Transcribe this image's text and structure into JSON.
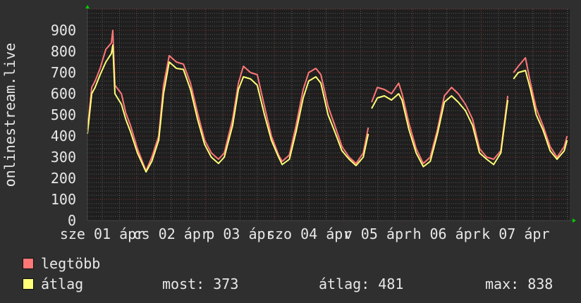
{
  "chart_data": {
    "type": "line",
    "ylabel": "onlinestream.live",
    "ylim": [
      0,
      1000
    ],
    "yticks": [
      0,
      100,
      200,
      300,
      400,
      500,
      600,
      700,
      800,
      900
    ],
    "xlim": [
      "04-01 06:50",
      "04-08 06:50"
    ],
    "xtick_labels": [
      "sze 01 ápr",
      "cs 02 ápr",
      "p 03 ápr",
      "szo 04 ápr",
      "v 05 ápr",
      "h 06 ápr",
      "k 07 ápr"
    ],
    "xtick_times": [
      "04-01 12:00",
      "04-02 12:00",
      "04-03 12:00",
      "04-04 12:00",
      "04-05 12:00",
      "04-06 12:00",
      "04-07 12:00"
    ],
    "grid": true,
    "colors": {
      "background": "#2f2f2f",
      "plot": "#1e1e1e",
      "grid_minor": "#5a5a5a",
      "grid_major": "#8a3a3a",
      "axis_arrow": "#00cc00"
    },
    "x": [
      "04-01 06:50",
      "04-01 08:20",
      "04-01 09:30",
      "04-01 11:15",
      "04-01 13:15",
      "04-01 15:10",
      "04-01 15:40",
      "04-01 16:25",
      "04-01 18:40",
      "04-01 20:10",
      "04-01 21:50",
      "04-02 00:15",
      "04-02 03:15",
      "04-02 05:15",
      "04-02 07:40",
      "04-02 09:20",
      "04-02 11:20",
      "04-02 13:50",
      "04-02 16:15",
      "04-02 18:45",
      "04-02 21:10",
      "04-02 23:40",
      "04-03 02:00",
      "04-03 04:30",
      "04-03 06:30",
      "04-03 09:25",
      "04-03 11:25",
      "04-03 13:10",
      "04-03 15:40",
      "04-03 18:00",
      "04-03 20:30",
      "04-03 22:55",
      "04-04 01:25",
      "04-04 02:40",
      "04-04 05:10",
      "04-04 07:30",
      "04-04 10:00",
      "04-04 11:55",
      "04-04 14:25",
      "04-04 16:10",
      "04-04 18:40",
      "04-04 21:00",
      "04-04 23:30",
      "04-05 02:00",
      "04-05 04:25",
      "04-05 06:55",
      "04-05 08:40",
      "04-05 09:15",
      "04-05 09:50",
      "04-05 11:50",
      "04-05 14:15",
      "04-05 16:45",
      "04-05 19:15",
      "04-05 20:25",
      "04-05 22:50",
      "04-06 01:20",
      "04-06 03:50",
      "04-06 06:15",
      "04-06 08:45",
      "04-06 11:10",
      "04-06 13:40",
      "04-06 16:00",
      "04-06 18:30",
      "04-06 21:00",
      "04-06 23:25",
      "04-07 01:55",
      "04-07 04:20",
      "04-07 06:50",
      "04-07 09:15",
      "04-07 10:15",
      "04-07 11:15",
      "04-07 12:55",
      "04-07 15:25",
      "04-07 17:10",
      "04-07 19:10",
      "04-07 21:30",
      "04-08 00:00",
      "04-08 02:25",
      "04-08 04:55",
      "04-08 05:55"
    ],
    "series": [
      {
        "name": "legtöbb",
        "color": "#ff7777",
        "values": [
          430,
          630,
          660,
          720,
          810,
          840,
          900,
          640,
          600,
          510,
          450,
          340,
          235,
          300,
          400,
          640,
          780,
          750,
          740,
          650,
          510,
          380,
          320,
          290,
          320,
          480,
          650,
          730,
          700,
          690,
          540,
          400,
          310,
          280,
          310,
          450,
          620,
          700,
          720,
          690,
          540,
          450,
          350,
          300,
          270,
          320,
          440,
          null,
          560,
          630,
          620,
          600,
          650,
          600,
          460,
          340,
          270,
          300,
          430,
          590,
          630,
          600,
          550,
          480,
          340,
          300,
          290,
          330,
          590,
          null,
          700,
          730,
          770,
          650,
          530,
          450,
          350,
          300,
          350,
          400
        ]
      },
      {
        "name": "átlag",
        "color": "#ffff77",
        "values": [
          410,
          600,
          630,
          690,
          750,
          790,
          830,
          600,
          550,
          480,
          420,
          320,
          230,
          280,
          380,
          600,
          750,
          720,
          715,
          620,
          480,
          360,
          300,
          270,
          300,
          450,
          620,
          680,
          670,
          640,
          500,
          380,
          300,
          265,
          290,
          420,
          580,
          660,
          680,
          650,
          500,
          420,
          330,
          290,
          260,
          300,
          410,
          null,
          530,
          580,
          590,
          570,
          600,
          570,
          430,
          320,
          255,
          280,
          410,
          560,
          590,
          560,
          520,
          450,
          320,
          290,
          265,
          320,
          570,
          null,
          670,
          700,
          710,
          620,
          500,
          430,
          330,
          290,
          330,
          380
        ]
      }
    ]
  },
  "legend": {
    "items": [
      {
        "label": "legtöbb",
        "color": "#ff7777"
      },
      {
        "label": "átlag",
        "color": "#ffff77"
      }
    ],
    "stats": {
      "now": "most: 373",
      "avg": "átlag: 481",
      "max": "max: 838"
    }
  }
}
